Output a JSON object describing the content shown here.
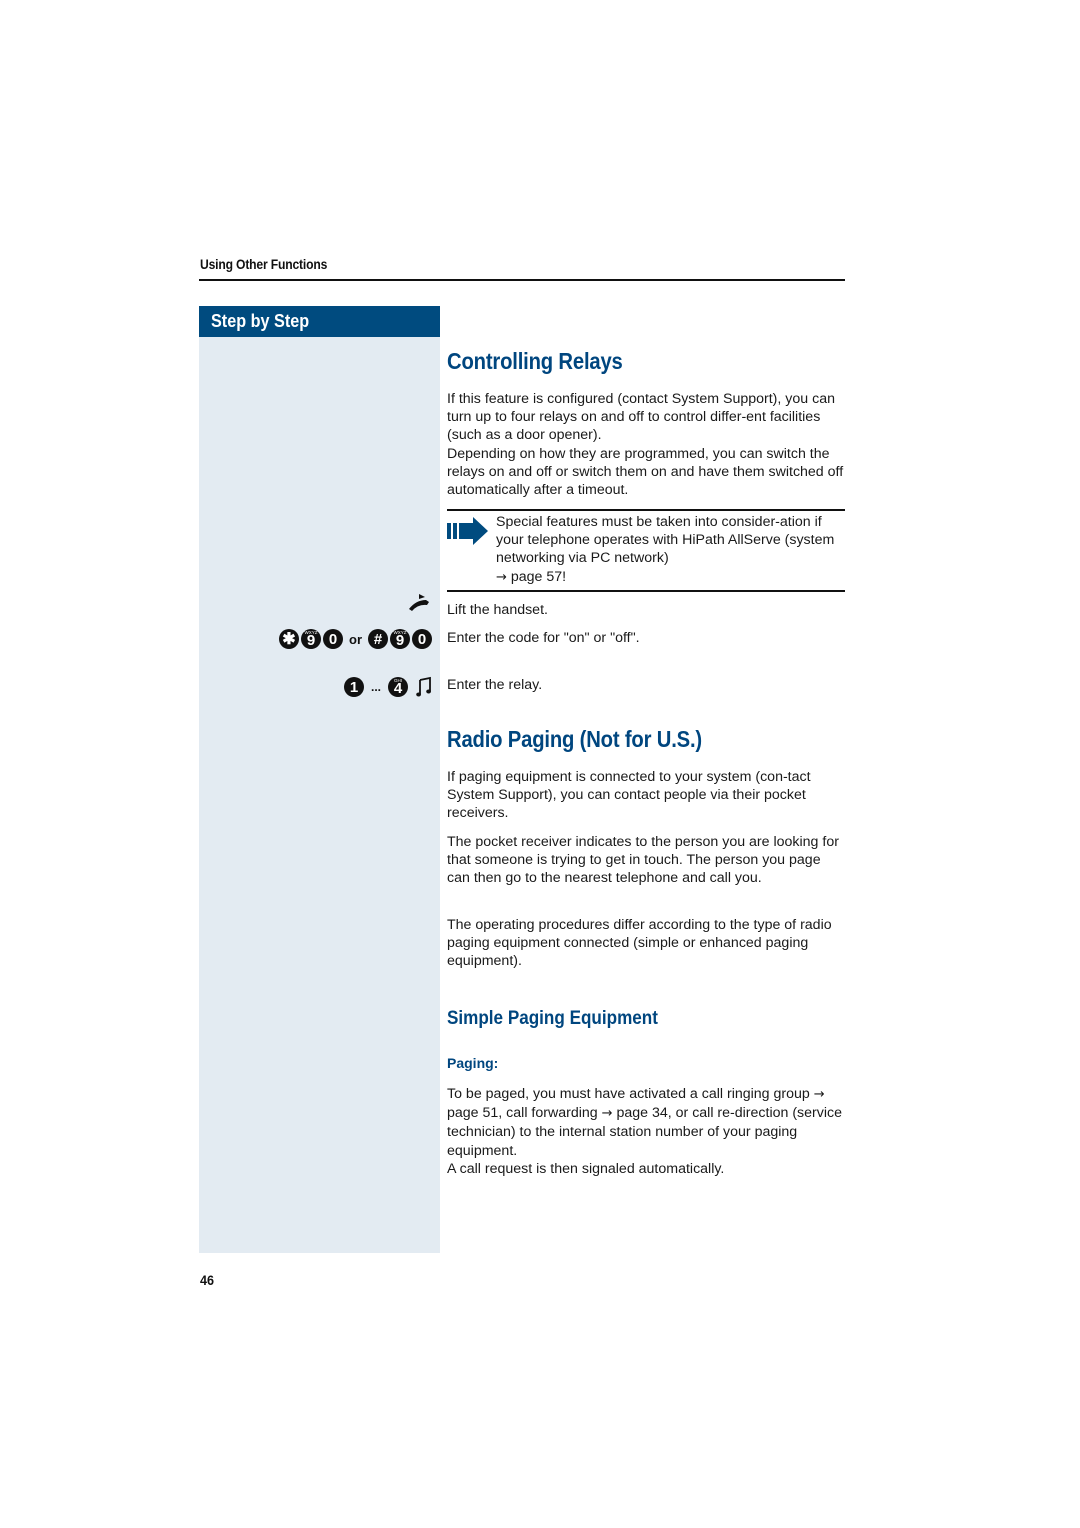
{
  "header": {
    "section_title": "Using Other Functions"
  },
  "sidebar": {
    "title": "Step by Step",
    "steps": [
      {
        "icon": "handset-lift-icon",
        "keys": []
      },
      {
        "keys_on": [
          {
            "main": "✱",
            "sub": ""
          },
          {
            "main": "9",
            "sub": "WXYZ"
          },
          {
            "main": "0",
            "sub": ""
          }
        ],
        "or_label": "or",
        "keys_off": [
          {
            "main": "#",
            "sub": ""
          },
          {
            "main": "9",
            "sub": "WXYZ"
          },
          {
            "main": "0",
            "sub": ""
          }
        ]
      },
      {
        "range_start": {
          "main": "1",
          "sub": ""
        },
        "range_sep": "...",
        "range_end": {
          "main": "4",
          "sub": "GHI"
        },
        "tone_icon": "music-note-icon"
      }
    ]
  },
  "controlling_relays": {
    "title": "Controlling Relays",
    "intro_lines": [
      "If this feature is configured (contact System Support), you can turn up to four relays on and off to control differ-ent facilities (such as a door opener).",
      "Depending on how they are programmed, you can switch the relays on and off or switch them on and have them switched off automatically after a timeout."
    ],
    "note": {
      "text": "Special features must be taken into consider-ation if your telephone operates with HiPath AllServe (system networking via PC network)",
      "ref_arrow": "→",
      "ref": "page 57!"
    },
    "steps": [
      "Lift the handset.",
      "Enter the code for \"on\" or \"off\".",
      "Enter the relay."
    ]
  },
  "radio_paging": {
    "title": "Radio Paging (Not for U.S.)",
    "paragraphs": [
      "If paging equipment is connected to your system (con-tact System Support), you can contact people via their pocket receivers.",
      "The pocket receiver indicates to the person you are looking for that someone is trying to get in touch. The person you page can then go to the nearest telephone and call you.",
      "The operating procedures differ according to the type of radio paging equipment connected (simple or enhanced paging equipment)."
    ]
  },
  "simple_paging": {
    "title": "Simple Paging Equipment",
    "subheading": "Paging:",
    "body": {
      "part1": "To be paged, you must have activated a call ringing group ",
      "ref1": "page 51",
      "part2": ", call forwarding ",
      "ref2": "page 34",
      "part3": ", or call re-direction (service technician) to the internal station number of your paging equipment.",
      "arrow": "→",
      "line2": "A call request is then signaled automatically."
    }
  },
  "footer": {
    "page_number": "46"
  },
  "colors": {
    "brand_blue": "#004b7f",
    "heading_blue": "#00467f",
    "sidebar_bg": "#e3ebf2"
  }
}
